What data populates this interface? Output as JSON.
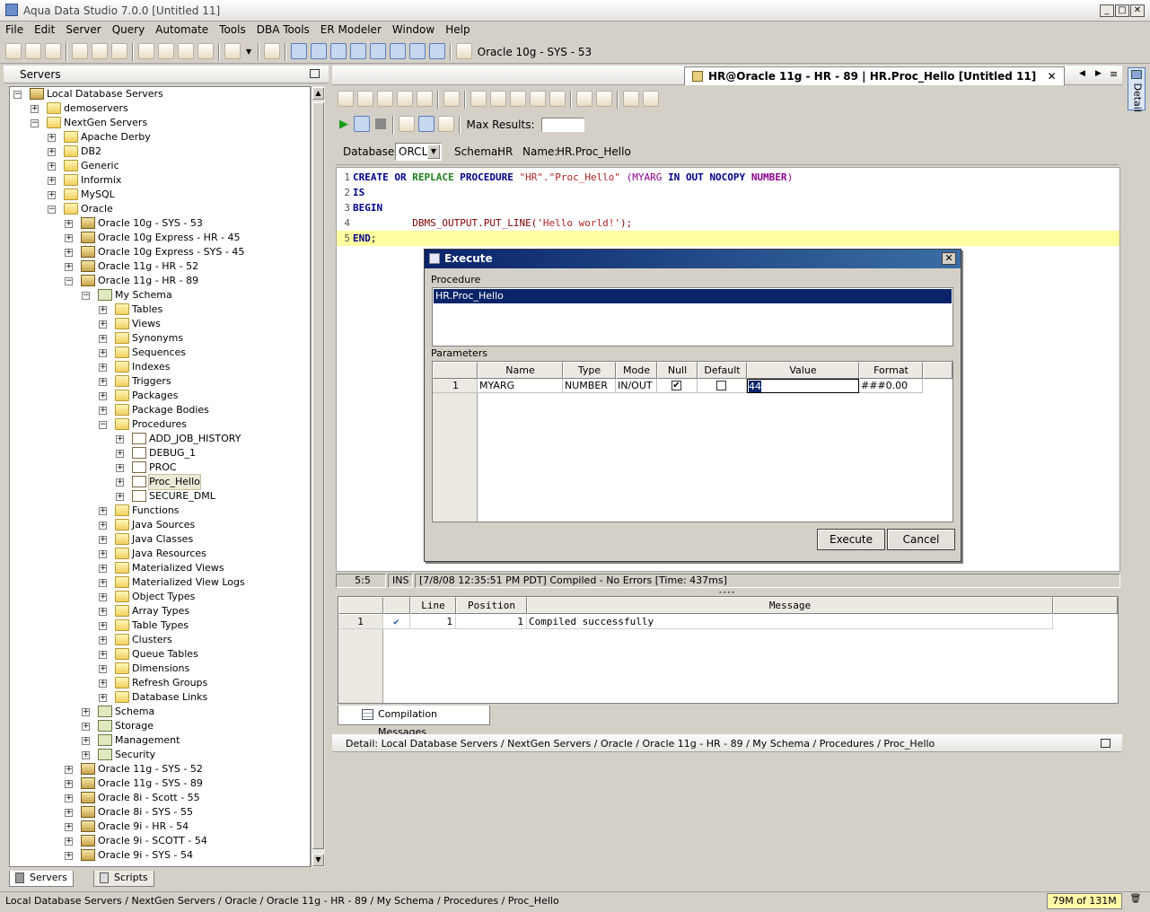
{
  "window": {
    "title": "Aqua Data Studio 7.0.0 [Untitled 11]",
    "min": "_",
    "max": "□",
    "close": "✕"
  },
  "menu": [
    "File",
    "Edit",
    "Server",
    "Query",
    "Automate",
    "Tools",
    "DBA Tools",
    "ER Modeler",
    "Window",
    "Help"
  ],
  "toolbar": {
    "server_label": "Oracle 10g - SYS - 53"
  },
  "servers_panel": {
    "title": "Servers",
    "tree": [
      {
        "label": "Local Database Servers",
        "level": 0,
        "expanded": true,
        "icon": "server-group-icon"
      },
      {
        "label": "demoservers",
        "level": 1,
        "expanded": false,
        "icon": "folder-icon"
      },
      {
        "label": "NextGen Servers",
        "level": 1,
        "expanded": true,
        "icon": "folder-icon"
      },
      {
        "label": "Apache Derby",
        "level": 2,
        "expanded": false,
        "icon": "folder-icon"
      },
      {
        "label": "DB2",
        "level": 2,
        "expanded": false,
        "icon": "folder-icon"
      },
      {
        "label": "Generic",
        "level": 2,
        "expanded": false,
        "icon": "folder-icon"
      },
      {
        "label": "Informix",
        "level": 2,
        "expanded": false,
        "icon": "folder-icon"
      },
      {
        "label": "MySQL",
        "level": 2,
        "expanded": false,
        "icon": "folder-icon"
      },
      {
        "label": "Oracle",
        "level": 2,
        "expanded": true,
        "icon": "folder-icon"
      },
      {
        "label": "Oracle 10g - SYS - 53",
        "level": 3,
        "expanded": false,
        "icon": "server-icon"
      },
      {
        "label": "Oracle 10g Express - HR - 45",
        "level": 3,
        "expanded": false,
        "icon": "server-icon"
      },
      {
        "label": "Oracle 10g Express - SYS - 45",
        "level": 3,
        "expanded": false,
        "icon": "server-icon"
      },
      {
        "label": "Oracle 11g - HR - 52",
        "level": 3,
        "expanded": false,
        "icon": "server-icon"
      },
      {
        "label": "Oracle 11g - HR - 89",
        "level": 3,
        "expanded": true,
        "icon": "server-icon"
      },
      {
        "label": "My Schema",
        "level": 4,
        "expanded": true,
        "icon": "schema-icon"
      },
      {
        "label": "Tables",
        "level": 5,
        "expanded": false,
        "icon": "folder-icon"
      },
      {
        "label": "Views",
        "level": 5,
        "expanded": false,
        "icon": "folder-icon"
      },
      {
        "label": "Synonyms",
        "level": 5,
        "expanded": false,
        "icon": "folder-icon"
      },
      {
        "label": "Sequences",
        "level": 5,
        "expanded": false,
        "icon": "folder-icon"
      },
      {
        "label": "Indexes",
        "level": 5,
        "expanded": false,
        "icon": "folder-icon"
      },
      {
        "label": "Triggers",
        "level": 5,
        "expanded": false,
        "icon": "folder-icon"
      },
      {
        "label": "Packages",
        "level": 5,
        "expanded": false,
        "icon": "folder-icon"
      },
      {
        "label": "Package Bodies",
        "level": 5,
        "expanded": false,
        "icon": "folder-icon"
      },
      {
        "label": "Procedures",
        "level": 5,
        "expanded": true,
        "icon": "folder-icon"
      },
      {
        "label": "ADD_JOB_HISTORY",
        "level": 6,
        "expanded": false,
        "icon": "procedure-icon"
      },
      {
        "label": "DEBUG_1",
        "level": 6,
        "expanded": false,
        "icon": "procedure-icon"
      },
      {
        "label": "PROC",
        "level": 6,
        "expanded": false,
        "icon": "procedure-icon"
      },
      {
        "label": "Proc_Hello",
        "level": 6,
        "expanded": false,
        "icon": "procedure-icon",
        "selected": true
      },
      {
        "label": "SECURE_DML",
        "level": 6,
        "expanded": false,
        "icon": "procedure-icon"
      },
      {
        "label": "Functions",
        "level": 5,
        "expanded": false,
        "icon": "folder-icon"
      },
      {
        "label": "Java Sources",
        "level": 5,
        "expanded": false,
        "icon": "folder-icon"
      },
      {
        "label": "Java Classes",
        "level": 5,
        "expanded": false,
        "icon": "folder-icon"
      },
      {
        "label": "Java Resources",
        "level": 5,
        "expanded": false,
        "icon": "folder-icon"
      },
      {
        "label": "Materialized Views",
        "level": 5,
        "expanded": false,
        "icon": "folder-icon"
      },
      {
        "label": "Materialized View Logs",
        "level": 5,
        "expanded": false,
        "icon": "folder-icon"
      },
      {
        "label": "Object Types",
        "level": 5,
        "expanded": false,
        "icon": "folder-icon"
      },
      {
        "label": "Array Types",
        "level": 5,
        "expanded": false,
        "icon": "folder-icon"
      },
      {
        "label": "Table Types",
        "level": 5,
        "expanded": false,
        "icon": "folder-icon"
      },
      {
        "label": "Clusters",
        "level": 5,
        "expanded": false,
        "icon": "folder-icon"
      },
      {
        "label": "Queue Tables",
        "level": 5,
        "expanded": false,
        "icon": "folder-icon"
      },
      {
        "label": "Dimensions",
        "level": 5,
        "expanded": false,
        "icon": "folder-icon"
      },
      {
        "label": "Refresh Groups",
        "level": 5,
        "expanded": false,
        "icon": "folder-icon"
      },
      {
        "label": "Database Links",
        "level": 5,
        "expanded": false,
        "icon": "folder-icon"
      },
      {
        "label": "Schema",
        "level": 4,
        "expanded": false,
        "icon": "schema-icon"
      },
      {
        "label": "Storage",
        "level": 4,
        "expanded": false,
        "icon": "schema-icon"
      },
      {
        "label": "Management",
        "level": 4,
        "expanded": false,
        "icon": "schema-icon"
      },
      {
        "label": "Security",
        "level": 4,
        "expanded": false,
        "icon": "schema-icon"
      },
      {
        "label": "Oracle 11g - SYS - 52",
        "level": 3,
        "expanded": false,
        "icon": "server-icon"
      },
      {
        "label": "Oracle 11g - SYS - 89",
        "level": 3,
        "expanded": false,
        "icon": "server-icon"
      },
      {
        "label": "Oracle 8i - Scott - 55",
        "level": 3,
        "expanded": false,
        "icon": "server-icon"
      },
      {
        "label": "Oracle 8i - SYS - 55",
        "level": 3,
        "expanded": false,
        "icon": "server-icon"
      },
      {
        "label": "Oracle 9i - HR - 54",
        "level": 3,
        "expanded": false,
        "icon": "server-icon"
      },
      {
        "label": "Oracle 9i - SCOTT - 54",
        "level": 3,
        "expanded": false,
        "icon": "server-icon"
      },
      {
        "label": "Oracle 9i - SYS - 54",
        "level": 3,
        "expanded": false,
        "icon": "server-icon"
      }
    ],
    "tabs": [
      "Servers",
      "Scripts"
    ]
  },
  "editor": {
    "tab_title": "HR@Oracle 11g - HR - 89 | HR.Proc_Hello [Untitled 11]",
    "max_results_label": "Max Results:",
    "max_results_value": "",
    "database_label": "Database:",
    "database_value": "ORCL",
    "schema_label": "Schema:",
    "schema_value": "HR",
    "name_label": "Name:",
    "name_value": "HR.Proc_Hello",
    "code_lines": [
      "1",
      "2",
      "3",
      "4",
      "5"
    ],
    "code": {
      "l1_create": "CREATE",
      "l1_or": "OR",
      "l1_replace": "REPLACE",
      "l1_procedure": "PROCEDURE",
      "l1_name": "\"HR\".\"Proc_Hello\"",
      "l1_open": "(MYARG",
      "l1_in": "IN",
      "l1_out": "OUT",
      "l1_nocopy": "NOCOPY",
      "l1_number": "NUMBER",
      "l1_close": ")",
      "l2": "IS",
      "l3": "BEGIN",
      "l4_call": "DBMS_OUTPUT.PUT_LINE(",
      "l4_str": "'Hello world!'",
      "l4_end": ");",
      "l5": "END",
      "l5_semi": ";"
    },
    "status": {
      "pos": "5:5",
      "mode": "INS",
      "message": "[7/8/08 12:35:51 PM PDT] Compiled - No Errors [Time: 437ms]"
    }
  },
  "results": {
    "headers": [
      "Line",
      "Position",
      "Message"
    ],
    "rows": [
      {
        "num": "1",
        "line": "1",
        "position": "1",
        "message": "Compiled successfully"
      }
    ],
    "tab": "Compilation Messages"
  },
  "detail": {
    "text": "Detail: Local Database Servers / NextGen Servers / Oracle / Oracle 11g - HR - 89 / My Schema / Procedures / Proc_Hello",
    "side_tab": "Detail"
  },
  "statusbar": {
    "path": "Local Database Servers / NextGen Servers / Oracle / Oracle 11g - HR - 89 / My Schema / Procedures / Proc_Hello",
    "memory": "79M of 131M"
  },
  "dialog": {
    "title": "Execute",
    "procedure_label": "Procedure",
    "procedure_item": "HR.Proc_Hello",
    "parameters_label": "Parameters",
    "headers": [
      "Name",
      "Type",
      "Mode",
      "Null",
      "Default",
      "Value",
      "Format"
    ],
    "row": {
      "num": "1",
      "name": "MYARG",
      "type": "NUMBER",
      "mode": "IN/OUT",
      "null": true,
      "default": false,
      "value": "44",
      "format": "###0.00"
    },
    "execute_button": "Execute",
    "cancel_button": "Cancel"
  }
}
